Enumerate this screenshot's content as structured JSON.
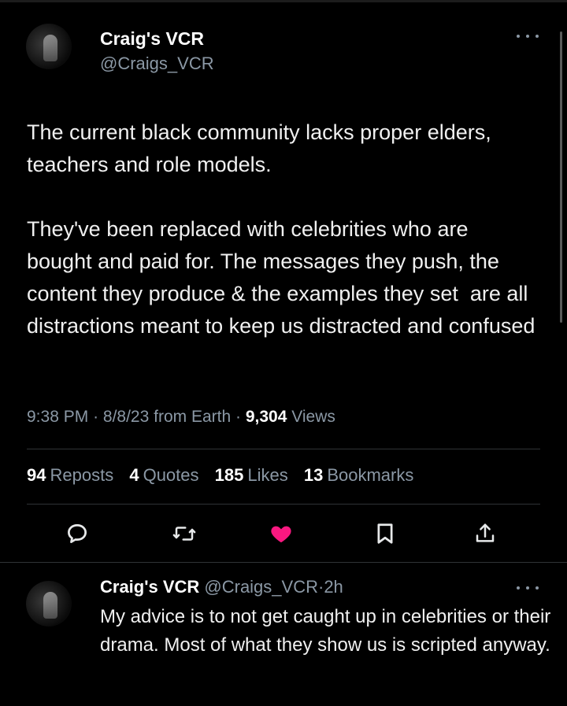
{
  "tweet": {
    "author_name": "Craig's VCR",
    "author_handle": "@Craigs_VCR",
    "text": "The current black community lacks proper elders, teachers and role models.\n\nThey've been replaced with celebrities who are bought and paid for. The messages they push, the content they produce & the examples they set  are all distractions meant to keep us distracted and confused",
    "time": "9:38 PM",
    "date": "8/8/23",
    "source": "from Earth",
    "views_count": "9,304",
    "views_label": "Views",
    "separator": "·"
  },
  "stats": {
    "reposts_count": "94",
    "reposts_label": "Reposts",
    "quotes_count": "4",
    "quotes_label": "Quotes",
    "likes_count": "185",
    "likes_label": "Likes",
    "bookmarks_count": "13",
    "bookmarks_label": "Bookmarks"
  },
  "actions": {
    "reply_icon": "reply-icon",
    "repost_icon": "repost-icon",
    "like_icon": "heart-icon",
    "bookmark_icon": "bookmark-icon",
    "share_icon": "share-icon",
    "liked": true
  },
  "reply": {
    "author_name": "Craig's VCR",
    "author_handle": "@Craigs_VCR",
    "time_ago": "2h",
    "separator": "·",
    "text": "My advice is to not get caught up in celebrities or their drama. Most of what they show us is scripted anyway."
  },
  "colors": {
    "background": "#000000",
    "text": "#e7e9ea",
    "secondary_text": "#8b98a5",
    "like_color": "#f91880",
    "divider": "#2f3336"
  }
}
